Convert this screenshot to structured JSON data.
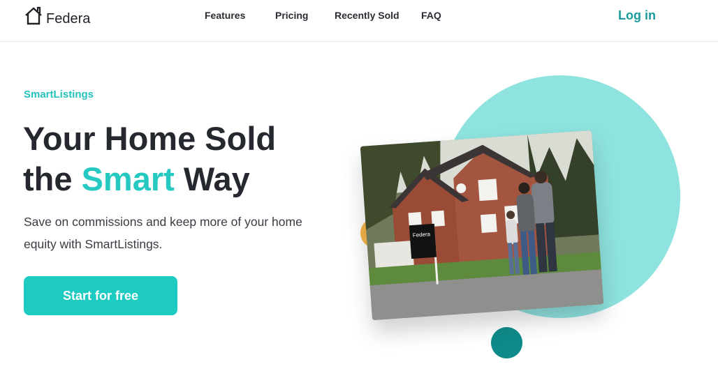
{
  "brand": {
    "name": "Federa",
    "icon": "house-outline-icon"
  },
  "nav": {
    "links": [
      {
        "label": "Features"
      },
      {
        "label": "Pricing"
      },
      {
        "label": "Recently Sold"
      },
      {
        "label": "FAQ"
      }
    ],
    "login_label": "Log in"
  },
  "hero": {
    "eyebrow": "SmartListings",
    "headline_line1": "Your Home Sold",
    "headline_pre": "the ",
    "headline_accent": "Smart",
    "headline_post": " Way",
    "subtext": "Save on commissions and keep more of your home equity with SmartListings.",
    "cta_label": "Start for free"
  },
  "photo": {
    "sign_text": "Federa",
    "description_icon": "family-house-photo"
  },
  "colors": {
    "accent": "#25c9c1",
    "cta": "#1ecbc0",
    "login": "#1a9a9a",
    "circle_light": "#8ee3de",
    "circle_dark": "#0e8a8a",
    "circle_orange": "#f6b347"
  }
}
